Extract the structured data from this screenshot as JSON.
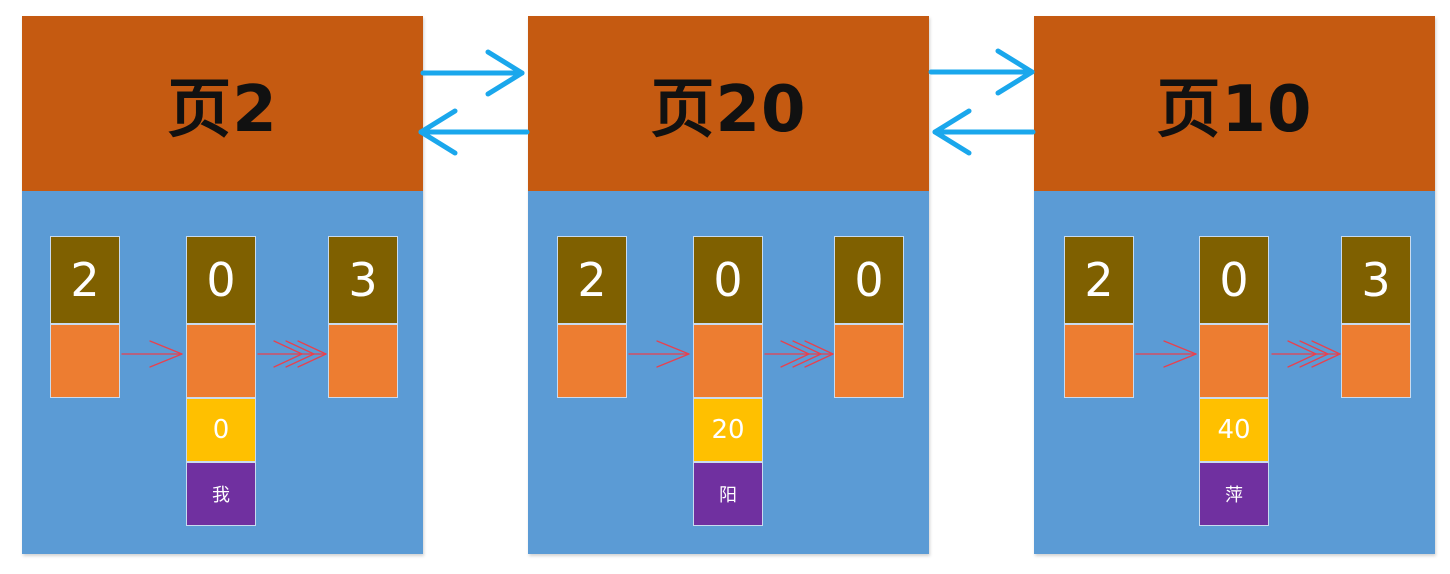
{
  "pages": [
    {
      "title": "页2",
      "slots": [
        "2",
        "0",
        "3"
      ],
      "key": "0",
      "value": "我"
    },
    {
      "title": "页20",
      "slots": [
        "2",
        "0",
        "0"
      ],
      "key": "20",
      "value": "阳"
    },
    {
      "title": "页10",
      "slots": [
        "2",
        "0",
        "3"
      ],
      "key": "40",
      "value": "萍"
    }
  ],
  "colors": {
    "page_header": "#C55A11",
    "page_body": "#5B9BD5",
    "slot": "#7F6000",
    "pointer": "#ED7D31",
    "key": "#FFC000",
    "value": "#7030A0",
    "page_link_arrow": "#1AA7EC",
    "record_link_arrow": "#E8414E"
  }
}
